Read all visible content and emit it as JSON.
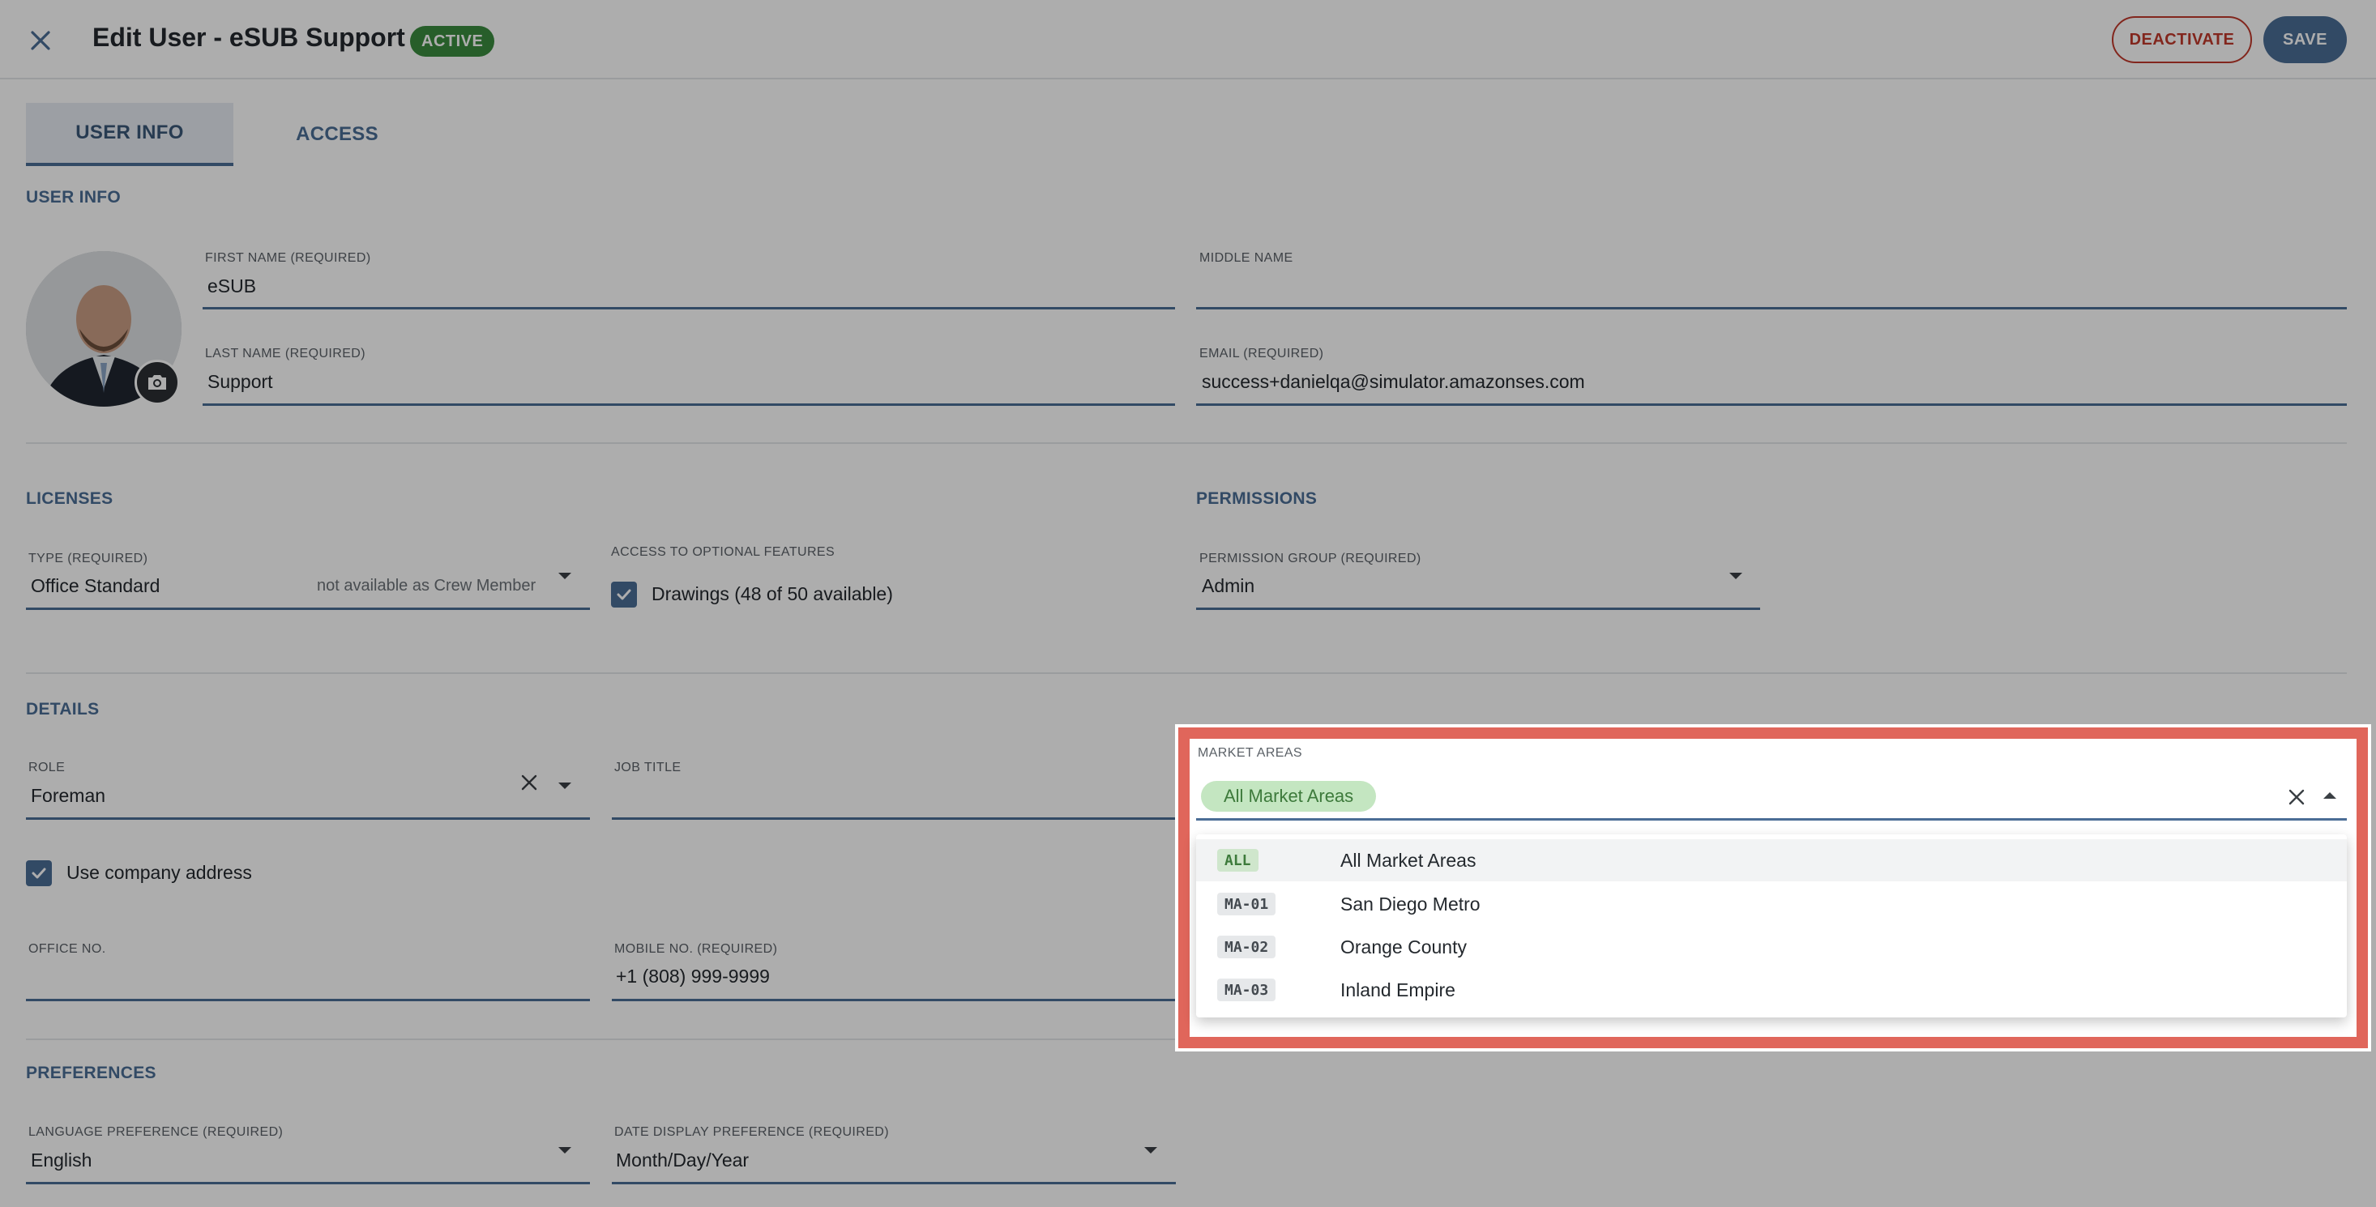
{
  "header": {
    "title": "Edit User - eSUB Support",
    "status": "ACTIVE",
    "deactivate_label": "DEACTIVATE",
    "save_label": "SAVE"
  },
  "tabs": [
    {
      "label": "USER INFO",
      "active": true
    },
    {
      "label": "ACCESS",
      "active": false
    }
  ],
  "user_info": {
    "section_title": "USER INFO",
    "first_name": {
      "label": "FIRST NAME (REQUIRED)",
      "value": "eSUB"
    },
    "middle_name": {
      "label": "MIDDLE NAME",
      "value": ""
    },
    "last_name": {
      "label": "LAST NAME (REQUIRED)",
      "value": "Support"
    },
    "email": {
      "label": "EMAIL (REQUIRED)",
      "value": "success+danielqa@simulator.amazonses.com"
    }
  },
  "licenses": {
    "section_title": "LICENSES",
    "type": {
      "label": "TYPE (REQUIRED)",
      "value": "Office Standard",
      "note": "not available as Crew Member"
    },
    "optional_features_label": "ACCESS TO OPTIONAL FEATURES",
    "drawings": {
      "label": "Drawings (48 of 50 available)",
      "checked": true
    }
  },
  "permissions": {
    "section_title": "PERMISSIONS",
    "group": {
      "label": "PERMISSION GROUP (REQUIRED)",
      "value": "Admin"
    }
  },
  "details": {
    "section_title": "DETAILS",
    "role": {
      "label": "ROLE",
      "value": "Foreman"
    },
    "job_title": {
      "label": "JOB TITLE",
      "value": ""
    },
    "use_company_address": {
      "label": "Use company address",
      "checked": true
    },
    "office_no": {
      "label": "OFFICE NO.",
      "value": ""
    },
    "mobile_no": {
      "label": "MOBILE NO. (REQUIRED)",
      "value": "+1 (808) 999-9999"
    }
  },
  "market_areas": {
    "label": "MARKET AREAS",
    "selected_chip": "All Market Areas",
    "options": [
      {
        "code": "ALL",
        "label": "All Market Areas",
        "highlighted": true
      },
      {
        "code": "MA-01",
        "label": "San Diego Metro",
        "highlighted": false
      },
      {
        "code": "MA-02",
        "label": "Orange County",
        "highlighted": false
      },
      {
        "code": "MA-03",
        "label": "Inland Empire",
        "highlighted": false
      }
    ]
  },
  "preferences": {
    "section_title": "PREFERENCES",
    "language": {
      "label": "LANGUAGE PREFERENCE (REQUIRED)",
      "value": "English"
    },
    "date_display": {
      "label": "DATE DISPLAY PREFERENCE (REQUIRED)",
      "value": "Month/Day/Year"
    }
  },
  "colors": {
    "accent": "#4b6d96",
    "active_badge": "#3a8b3e",
    "deactivate": "#c0392b",
    "highlight_border": "#e0665b",
    "chip_bg": "#c4e6c1"
  },
  "icons": {
    "close": "close-icon",
    "camera": "camera-icon",
    "checkbox": "check-icon",
    "dropdown": "chevron-down-icon",
    "clear": "clear-icon"
  }
}
